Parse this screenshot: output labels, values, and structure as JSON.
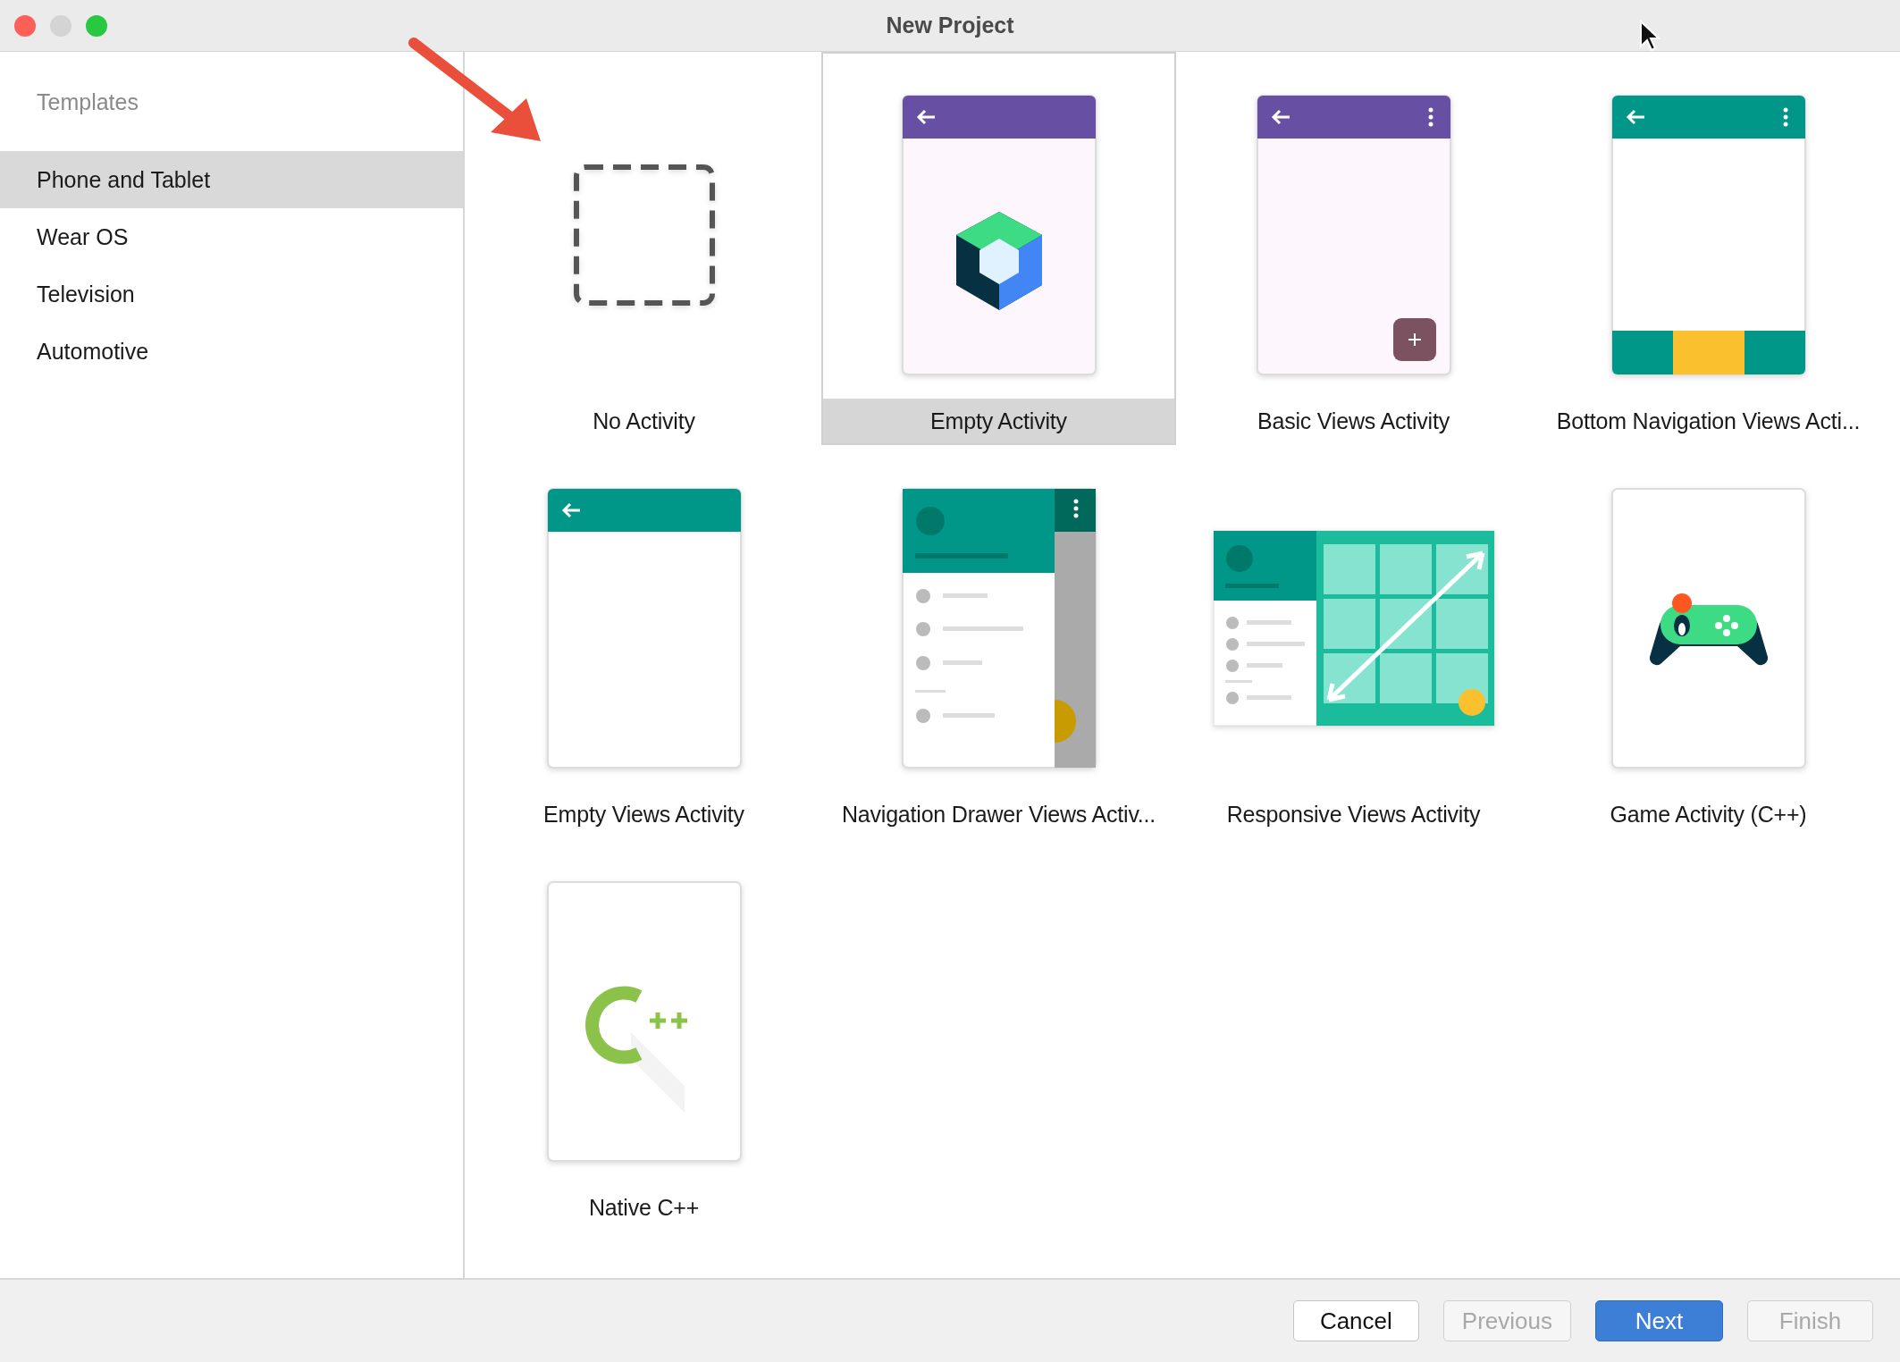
{
  "window": {
    "title": "New Project"
  },
  "sidebar": {
    "heading": "Templates",
    "items": [
      {
        "label": "Phone and Tablet",
        "selected": true
      },
      {
        "label": "Wear OS",
        "selected": false
      },
      {
        "label": "Television",
        "selected": false
      },
      {
        "label": "Automotive",
        "selected": false
      }
    ]
  },
  "templates": [
    {
      "label": "No Activity",
      "kind": "none",
      "selected": false
    },
    {
      "label": "Empty Activity",
      "kind": "compose",
      "selected": true
    },
    {
      "label": "Basic Views Activity",
      "kind": "basic",
      "selected": false
    },
    {
      "label": "Bottom Navigation Views Acti...",
      "kind": "bottomnav",
      "selected": false
    },
    {
      "label": "Empty Views Activity",
      "kind": "emptyviews",
      "selected": false
    },
    {
      "label": "Navigation Drawer Views Activ...",
      "kind": "navdrawer",
      "selected": false
    },
    {
      "label": "Responsive Views Activity",
      "kind": "responsive",
      "selected": false
    },
    {
      "label": "Game Activity (C++)",
      "kind": "game",
      "selected": false
    },
    {
      "label": "Native C++",
      "kind": "cpp",
      "selected": false
    }
  ],
  "buttons": [
    {
      "label": "Cancel",
      "kind": "default",
      "disabled": false
    },
    {
      "label": "Previous",
      "kind": "default",
      "disabled": true
    },
    {
      "label": "Next",
      "kind": "primary",
      "disabled": false
    },
    {
      "label": "Finish",
      "kind": "default",
      "disabled": true
    }
  ]
}
